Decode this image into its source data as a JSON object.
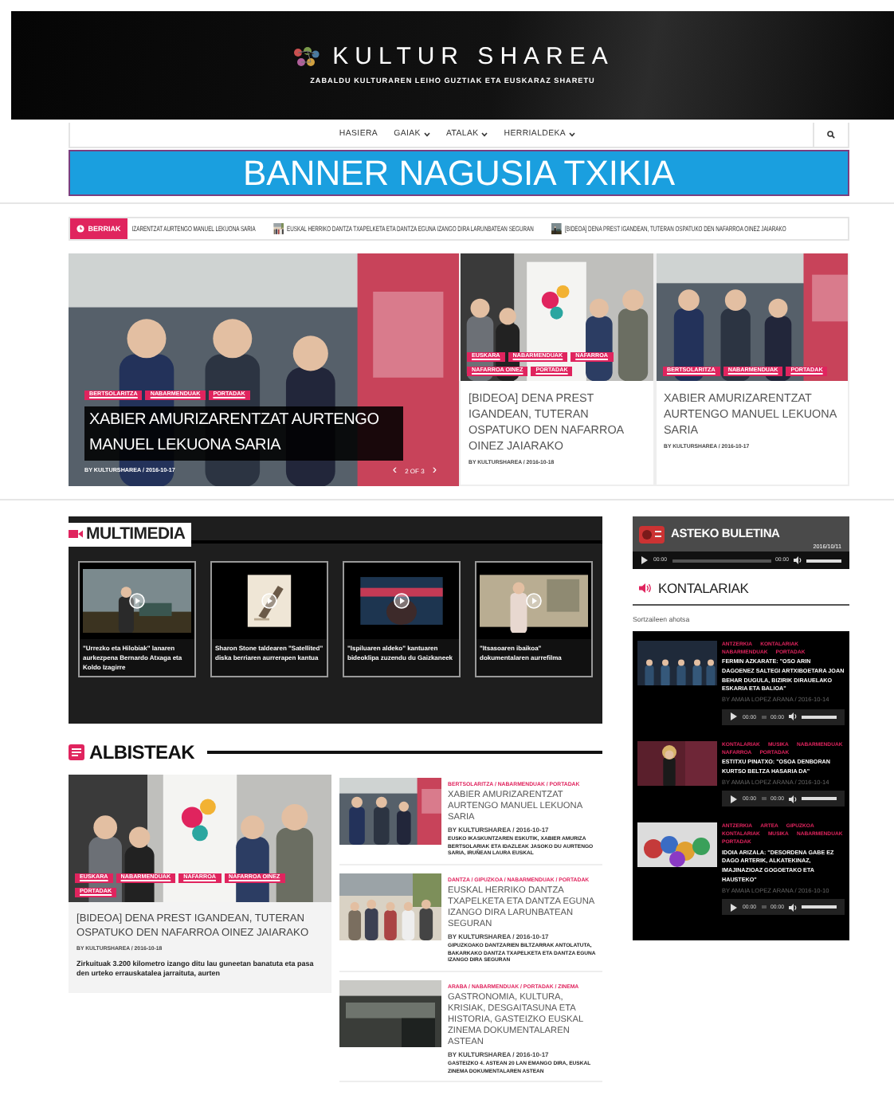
{
  "header": {
    "title": "KULTUR SHAREA",
    "tagline": "ZABALDU KULTURAREN LEIHO GUZTIAK ETA EUSKARAZ SHARETU"
  },
  "nav": {
    "items": [
      {
        "label": "HASIERA",
        "dropdown": false
      },
      {
        "label": "GAIAK",
        "dropdown": true
      },
      {
        "label": "ATALAK",
        "dropdown": true
      },
      {
        "label": "HERRIALDEKA",
        "dropdown": true
      }
    ]
  },
  "banner": {
    "text": "BANNER NAGUSIA TXIKIA"
  },
  "ticker": {
    "label": "BERRIAK",
    "items": [
      {
        "text": "IZARENTZAT AURTENGO MANUEL LEKUONA SARIA",
        "thumbnail": false
      },
      {
        "text": "EUSKAL HERRIKO DANTZA TXAPELKETA ETA DANTZA EGUNA IZANGO DIRA LARUNBATEAN SEGURAN",
        "thumbnail": true
      },
      {
        "text": "[BIDEOA] DENA PREST IGANDEAN, TUTERAN OSPATUKO DEN NAFARROA OINEZ JAIARAKO",
        "thumbnail": true
      }
    ]
  },
  "hero": {
    "main": {
      "tags": [
        "BERTSOLARITZA",
        "NABARMENDUAK",
        "PORTADAK"
      ],
      "title": "XABIER AMURIZARENTZAT AURTENGO MANUEL LEKUONA SARIA",
      "meta": "BY KULTURSHAREA / 2016-10-17",
      "prev": "‹",
      "pager": "2 OF 3",
      "next": "›"
    },
    "cards": [
      {
        "tags": [
          "EUSKARA",
          "NABARMENDUAK",
          "NAFARROA",
          "NAFARROA OINEZ",
          "PORTADAK"
        ],
        "title": "[BIDEOA] DENA PREST IGANDEAN, TUTERAN OSPATUKO DEN NAFARROA OINEZ JAIARAKO",
        "meta": "BY KULTURSHAREA / 2016-10-18"
      },
      {
        "tags": [
          "BERTSOLARITZA",
          "NABARMENDUAK",
          "PORTADAK"
        ],
        "title": "XABIER AMURIZARENTZAT AURTENGO MANUEL LEKUONA SARIA",
        "meta": "BY KULTURSHAREA / 2016-10-17"
      }
    ]
  },
  "multimedia": {
    "title": "MULTIMEDIA",
    "videos": [
      {
        "caption": "\"Urrezko eta Hilobiak\" lanaren aurkezpena Bernardo Atxaga eta Koldo Izagirre"
      },
      {
        "caption": "Sharon Stone taldearen \"Satellited\" diska berriaren aurrerapen kantua"
      },
      {
        "caption": "\"Ispiluaren aldeko\" kantuaren bideoklipa zuzendu du Gaizkaneek"
      },
      {
        "caption": "\"Itsasoaren ibaikoa\" dokumentalaren aurrefilma"
      }
    ]
  },
  "albisteak": {
    "title": "ALBISTEAK",
    "featured": {
      "tags": [
        "EUSKARA",
        "NABARMENDUAK",
        "NAFARROA",
        "NAFARROA OINEZ",
        "PORTADAK"
      ],
      "title": "[BIDEOA] DENA PREST IGANDEAN, TUTERAN OSPATUKO DEN NAFARROA OINEZ JAIARAKO",
      "meta": "BY KULTURSHAREA / 2016-10-18",
      "excerpt": "Zirkuituak 3.200 kilometro izango ditu lau guneetan banatuta eta pasa den urteko errauskatalea jarraituta, aurten"
    },
    "list": [
      {
        "tags": "BERTSOLARITZA / NABARMENDUAK / PORTADAK",
        "title": "XABIER AMURIZARENTZAT AURTENGO MANUEL LEKUONA SARIA",
        "meta": "BY KULTURSHAREA / 2016-10-17",
        "excerpt": "EUSKO IKASKUNTZAREN ESKUTIK, XABIER AMURIZA BERTSOLARIAK ETA IDAZLEAK JASOKO DU AURTENGO SARIA, IRUÑEAN LAURA EUSKAL"
      },
      {
        "tags": "DANTZA / GIPUZKOA / NABARMENDUAK / PORTADAK",
        "title": "EUSKAL HERRIKO DANTZA TXAPELKETA ETA DANTZA EGUNA IZANGO DIRA LARUNBATEAN SEGURAN",
        "meta": "BY KULTURSHAREA / 2016-10-17",
        "excerpt": "GIPUZKOAKO DANTZARIEN BILTZARRAK ANTOLATUTA, BAKARKAKO DANTZA TXAPELKETA ETA DANTZA EGUNA IZANGO DIRA SEGURAN"
      },
      {
        "tags": "ARABA / NABARMENDUAK / PORTADAK / ZINEMA",
        "title": "GASTRONOMIA, KULTURA, KRISIAK, DESGAITASUNA ETA HISTORIA, GASTEIZKO EUSKAL ZINEMA DOKUMENTALAREN ASTEAN",
        "meta": "BY KULTURSHAREA / 2016-10-17",
        "excerpt": "GASTEIZKO 4. ASTEAN 20 LAN EMANGO DIRA, EUSKAL ZINEMA DOKUMENTALAREN ASTEAN"
      }
    ]
  },
  "buletina": {
    "title": "ASTEKO BULETINA",
    "date": "2016/10/11",
    "player": {
      "current": "00:00",
      "duration": "00:00",
      "volume": {
        "level": 1
      }
    }
  },
  "kontalariak": {
    "title": "KONTALARIAK",
    "subtitle": "Sortzaileen ahotsa",
    "items": [
      {
        "tags": [
          "ANTZERKIA",
          "KONTALARIAK",
          "NABARMENDUAK",
          "PORTADAK"
        ],
        "title": "FERMIN AZKARATE: \"OSO ARIN DAGOENEZ SALTEGI ARTXIBOETARA JOAN BEHAR DUGULA, BIZIRIK DIRAUELAKO ESKARIA ETA BALIOA\"",
        "meta": "BY AMAIA LOPEZ ARANA / 2016-10-14",
        "player": {
          "current": "00:00",
          "duration": "00:00",
          "volume": {
            "level": 1
          }
        }
      },
      {
        "tags": [
          "KONTALARIAK",
          "MUSIKA",
          "NABARMENDUAK",
          "NAFARROA",
          "PORTADAK"
        ],
        "title": "ESTITXU PINATXO: \"OSOA DENBORAN KURTSO BELTZA HASARIA DA\"",
        "meta": "BY AMAIA LOPEZ ARANA / 2016-10-14",
        "player": {
          "current": "00:00",
          "duration": "00:00",
          "volume": {
            "level": 1
          }
        }
      },
      {
        "tags": [
          "ANTZERKIA",
          "ARTEA",
          "GIPUZKOA",
          "KONTALARIAK",
          "MUSIKA",
          "NABARMENDUAK",
          "PORTADAK"
        ],
        "title": "IDOIA ARIZALA: \"DESORDENA GABE EZ DAGO ARTERIK, ALKATEKINAZ, IMAJINAZIOAZ GOGOETAKO ETA HAUSTEKO\"",
        "meta": "BY AMAIA LOPEZ ARANA / 2016-10-10",
        "player": {
          "current": "00:00",
          "duration": "00:00",
          "volume": {
            "level": 1
          }
        }
      }
    ]
  }
}
